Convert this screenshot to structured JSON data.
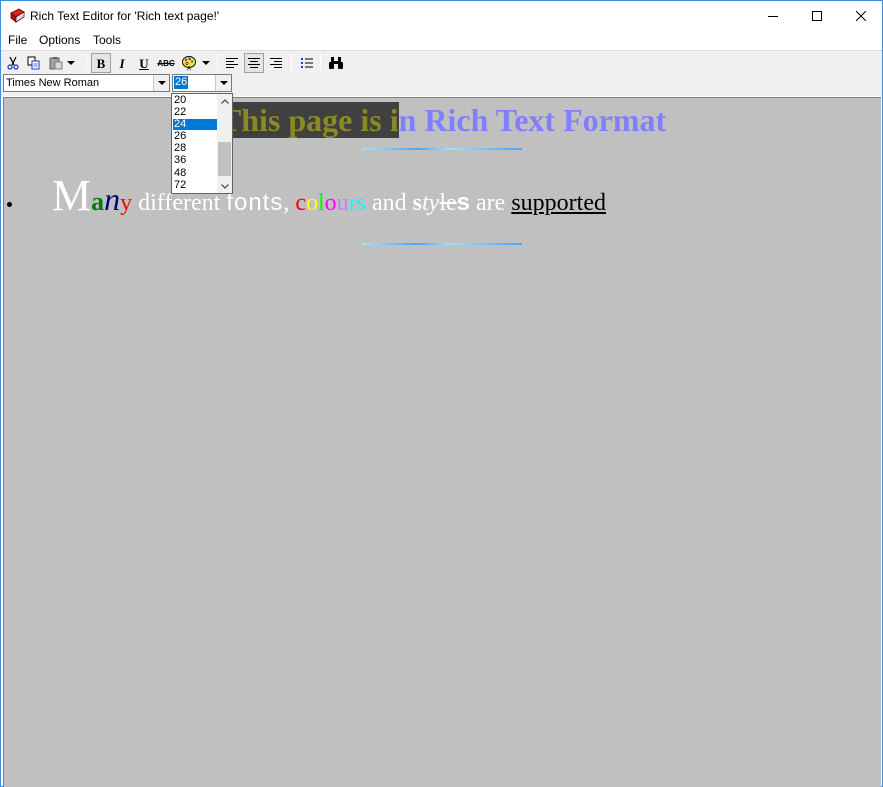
{
  "window": {
    "title": "Rich Text Editor for 'Rich text page!'",
    "minimize_icon": "minimize-icon",
    "maximize_icon": "maximize-icon",
    "close_icon": "close-icon"
  },
  "menu": {
    "file": "File",
    "options": "Options",
    "tools": "Tools"
  },
  "toolbar": {
    "bold": "B",
    "italic": "I",
    "underline": "U",
    "strike": "ABC"
  },
  "format": {
    "font_name": "Times New Roman",
    "font_size": "26",
    "size_options": [
      "20",
      "22",
      "24",
      "26",
      "28",
      "36",
      "48",
      "72"
    ],
    "highlighted_size": "24"
  },
  "document": {
    "heading_part1": "This page is i",
    "heading_part2": "n Rich Text Format",
    "heading_colors": {
      "part1_text": "#8a8a20",
      "part1_bg": "#404040",
      "part2_text": "#8080ff"
    },
    "background": "#c0c0c0",
    "line2": [
      {
        "text": "M",
        "color": "#ffffff"
      },
      {
        "text": "a",
        "color": "#008000"
      },
      {
        "text": "n",
        "color": "#000080"
      },
      {
        "text": "y",
        "color": "#ff0000"
      },
      {
        "text": " different ",
        "color": "#ffffff"
      },
      {
        "text": "fonts",
        "color": "#ffffff"
      },
      {
        "text": ", ",
        "color": "#ffffff"
      },
      {
        "text": "c",
        "color": "#ff0000"
      },
      {
        "text": "o",
        "color": "#ffff00"
      },
      {
        "text": "l",
        "color": "#00ff00"
      },
      {
        "text": "o",
        "color": "#ff00ff"
      },
      {
        "text": "u",
        "color": "#c080ff"
      },
      {
        "text": "r",
        "color": "#00ffff"
      },
      {
        "text": "s",
        "color": "#00ffff"
      },
      {
        "text": " and ",
        "color": "#ffffff"
      },
      {
        "text": "s",
        "color": "#ffffff"
      },
      {
        "text": "ty",
        "color": "#ffffff"
      },
      {
        "text": "l",
        "color": "#ffffff"
      },
      {
        "text": "e",
        "color": "#ffffff"
      },
      {
        "text": "s",
        "color": "#ffffff"
      },
      {
        "text": " are ",
        "color": "#ffffff"
      },
      {
        "text": "supported",
        "color": "#000000"
      }
    ]
  }
}
